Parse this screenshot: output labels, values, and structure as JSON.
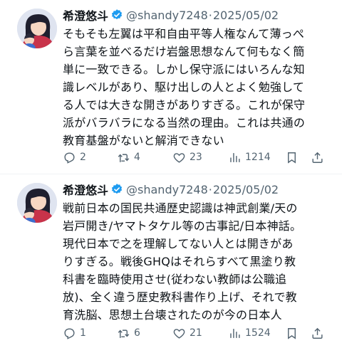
{
  "tweets": [
    {
      "author_name": "希澄悠斗",
      "handle": "@shandy7248",
      "separator": "·",
      "date": "2025/05/02",
      "text": "そもそも左翼は平和自由平等人権なんて薄っぺら言葉を並べるだけ岩盤思想なんて何もなく簡単に一致できる。しかし保守派にはいろんな知識レベルがあり、駆け出しの人とよく勉強してる人では大きな開きがありすぎる。これが保守派がバラバラになる当然の理由。これは共通の教育基盤がないと解消できない",
      "text_lines": [
        "そもそも左翼は平和自由平等人権なんて薄っぺ",
        "ら言葉を並べるだけ岩盤思想なんて何もなく簡",
        "単に一致できる。しかし保守派にはいろんな知",
        "識レベルがあり、駆け出しの人とよく勉強して",
        "る人では大きな開きがありすぎる。これが保守",
        "派がバラバラになる当然の理由。これは共通の",
        "教育基盤がないと解消できない"
      ],
      "replies": "2",
      "retweets": "4",
      "likes": "23",
      "views": "1214"
    },
    {
      "author_name": "希澄悠斗",
      "handle": "@shandy7248",
      "separator": "·",
      "date": "2025/05/02",
      "text_lines": [
        "戦前日本の国民共通歴史認識は神武創業/天の",
        "岩戸開き/ヤマトタケル等の古事記/日本神話。",
        "現代日本で之を理解してない人とは開きがあ",
        "りすぎる。戦後GHQはそれらすべて黒塗り教",
        "科書を臨時使用させ(従わない教師は公職追",
        "放)、全く違う歴史教科書作り上げ、それで教",
        "育洗脳、思想土台壊されたのが今の日本人"
      ],
      "replies": "1",
      "retweets": "6",
      "likes": "21",
      "views": "1524"
    }
  ],
  "colors": {
    "text": "#0f1419",
    "secondary": "#536471",
    "verified": "#1d9bf0",
    "divider": "#eff3f4"
  },
  "icons": [
    "verified-badge-icon",
    "reply-icon",
    "retweet-icon",
    "like-icon",
    "views-icon",
    "bookmark-icon",
    "share-icon"
  ]
}
